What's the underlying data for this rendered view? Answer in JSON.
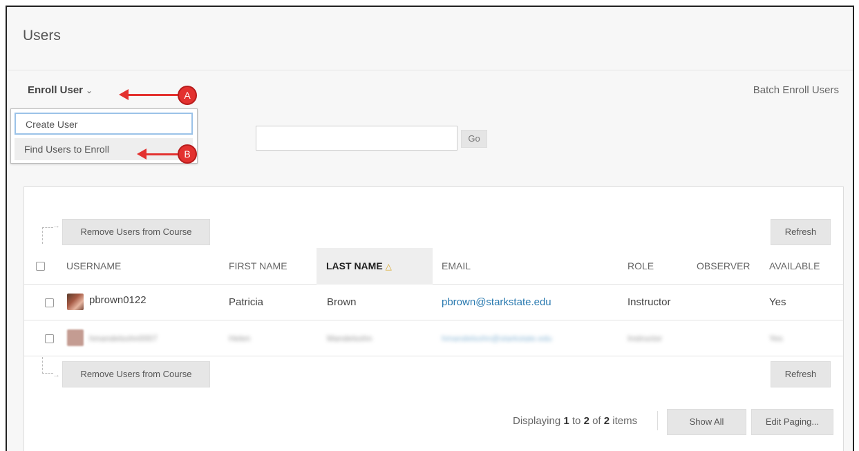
{
  "page": {
    "title": "Users"
  },
  "action_bar": {
    "enroll_label": "Enroll User",
    "batch_label": "Batch Enroll Users"
  },
  "dropdown": {
    "items": [
      {
        "label": "Create User"
      },
      {
        "label": "Find Users to Enroll"
      }
    ]
  },
  "search": {
    "value": "",
    "go_label": "Go"
  },
  "toolbar": {
    "remove_label": "Remove Users from Course",
    "refresh_label": "Refresh"
  },
  "table": {
    "columns": [
      "USERNAME",
      "FIRST NAME",
      "LAST NAME",
      "EMAIL",
      "ROLE",
      "OBSERVER",
      "AVAILABLE"
    ],
    "sorted_column": "LAST NAME",
    "rows": [
      {
        "username": "pbrown0122",
        "first_name": "Patricia",
        "last_name": "Brown",
        "email": "pbrown@starkstate.edu",
        "role": "Instructor",
        "observer": "",
        "available": "Yes"
      },
      {
        "username": "hmandelsohn0007",
        "first_name": "Helen",
        "last_name": "Mandelsohn",
        "email": "hmandelsohn@starkstate.edu",
        "role": "Instructor",
        "observer": "",
        "available": "Yes"
      }
    ]
  },
  "paging": {
    "prefix": "Displaying ",
    "from": "1",
    "to_word": " to ",
    "to": "2",
    "of_word": " of ",
    "total": "2",
    "suffix": " items",
    "show_all_label": "Show All",
    "edit_paging_label": "Edit Paging..."
  },
  "annotations": {
    "a": "A",
    "b": "B"
  },
  "colors": {
    "link": "#2a7ab0",
    "annotation": "#e3312f",
    "sort_indicator": "#d9a521"
  }
}
